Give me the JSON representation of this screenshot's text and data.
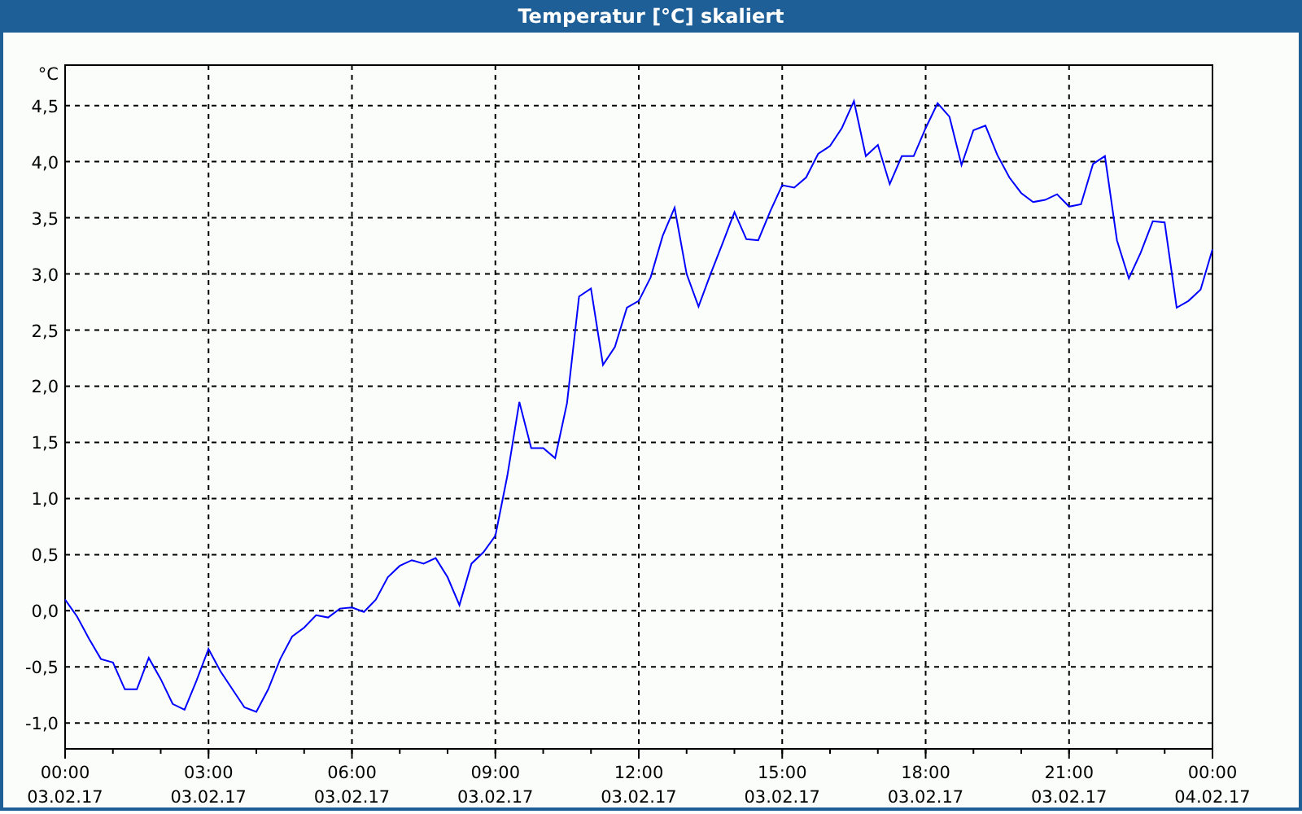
{
  "window": {
    "title": "Temperatur [°C] skaliert"
  },
  "chart": {
    "chart_data": {
      "type": "line",
      "grid": true,
      "ylabel": "°C",
      "ylim": [
        -1.23,
        4.86
      ],
      "categories": [
        "00:00\n03.02.17",
        null,
        null,
        null,
        null,
        null,
        null,
        null,
        null,
        null,
        null,
        null,
        "03:00\n03.02.17",
        null,
        null,
        null,
        null,
        null,
        null,
        null,
        null,
        null,
        null,
        null,
        "06:00\n03.02.17",
        null,
        null,
        null,
        null,
        null,
        null,
        null,
        null,
        null,
        null,
        null,
        "09:00\n03.02.17",
        null,
        null,
        null,
        null,
        null,
        null,
        null,
        null,
        null,
        null,
        null,
        "12:00\n03.02.17",
        null,
        null,
        null,
        null,
        null,
        null,
        null,
        null,
        null,
        null,
        null,
        "15:00\n03.02.17",
        null,
        null,
        null,
        null,
        null,
        null,
        null,
        null,
        null,
        null,
        null,
        "18:00\n03.02.17",
        null,
        null,
        null,
        null,
        null,
        null,
        null,
        null,
        null,
        null,
        null,
        "21:00\n03.02.17",
        null,
        null,
        null,
        null,
        null,
        null,
        null,
        null,
        null,
        null,
        null,
        "00:00\n04.02.17"
      ],
      "yticks": [
        {
          "value": -1,
          "label": "-1,0"
        },
        {
          "value": -0.5,
          "label": "-0,5"
        },
        {
          "value": 0,
          "label": "0,0"
        },
        {
          "value": 0.5,
          "label": "0,5"
        },
        {
          "value": 1,
          "label": "1,0"
        },
        {
          "value": 1.5,
          "label": "1,5"
        },
        {
          "value": 2,
          "label": "2,0"
        },
        {
          "value": 2.5,
          "label": "2,5"
        },
        {
          "value": 3,
          "label": "3,0"
        },
        {
          "value": 3.5,
          "label": "3,5"
        },
        {
          "value": 4,
          "label": "4,0"
        },
        {
          "value": 4.5,
          "label": "4,5"
        }
      ],
      "series": [
        {
          "color": "#0000ff",
          "values": [
            0.1,
            -0.05,
            -0.25,
            -0.43,
            -0.46,
            -0.7,
            -0.7,
            -0.42,
            -0.61,
            -0.83,
            -0.88,
            -0.62,
            -0.34,
            -0.54,
            -0.7,
            -0.86,
            -0.9,
            -0.7,
            -0.43,
            -0.23,
            -0.15,
            -0.04,
            -0.06,
            0.02,
            0.03,
            -0.01,
            0.1,
            0.3,
            0.4,
            0.45,
            0.42,
            0.47,
            0.3,
            0.05,
            0.42,
            0.52,
            0.67,
            1.2,
            1.86,
            1.45,
            1.45,
            1.36,
            1.85,
            2.8,
            2.87,
            2.19,
            2.35,
            2.7,
            2.76,
            2.97,
            3.34,
            3.59,
            3.0,
            2.71,
            3.0,
            3.27,
            3.55,
            3.31,
            3.3,
            3.56,
            3.79,
            3.77,
            3.86,
            4.07,
            4.14,
            4.3,
            4.54,
            4.05,
            4.15,
            3.8,
            4.05,
            4.05,
            4.3,
            4.52,
            4.4,
            3.97,
            4.28,
            4.32,
            4.06,
            3.86,
            3.72,
            3.64,
            3.66,
            3.71,
            3.6,
            3.62,
            3.98,
            4.05,
            3.3,
            2.96,
            3.19,
            3.47,
            3.46,
            2.7,
            2.76,
            2.86,
            3.22
          ]
        }
      ]
    }
  }
}
